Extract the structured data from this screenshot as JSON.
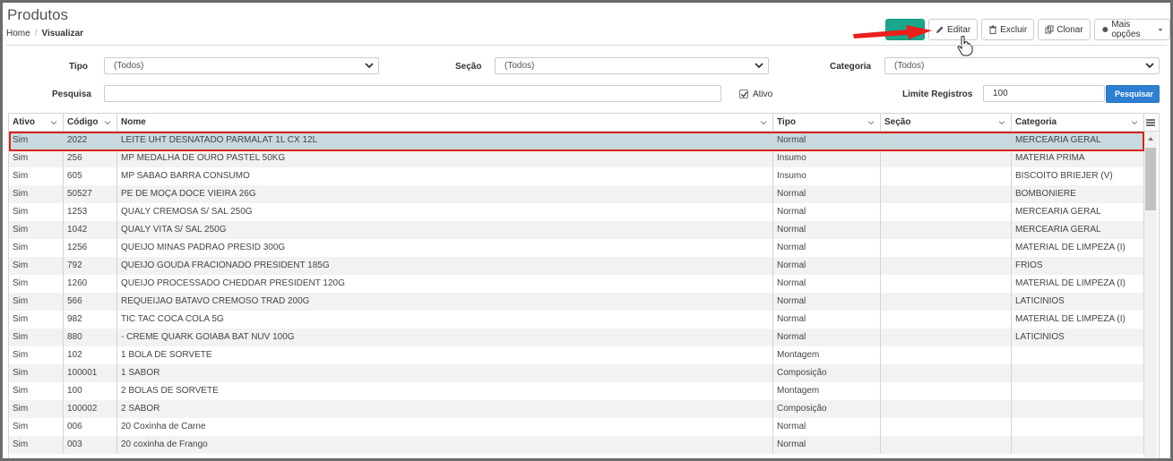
{
  "page": {
    "title": "Produtos"
  },
  "breadcrumb": {
    "home": "Home",
    "separator": "/",
    "current": "Visualizar"
  },
  "toolbar": {
    "editar": "Editar",
    "excluir": "Excluir",
    "clonar": "Clonar",
    "mais_opcoes": "Mais opções"
  },
  "filters": {
    "tipo_label": "Tipo",
    "tipo_value": "(Todos)",
    "secao_label": "Seção",
    "secao_value": "(Todos)",
    "categoria_label": "Categoria",
    "categoria_value": "(Todos)",
    "pesquisa_label": "Pesquisa",
    "pesquisa_value": "",
    "ativo_label": "Ativo",
    "ativo_checked": true,
    "limite_label": "Limite Registros",
    "limite_value": "100",
    "pesquisar_button": "Pesquisar"
  },
  "grid": {
    "columns": [
      "Ativo",
      "Código",
      "Nome",
      "Tipo",
      "Seção",
      "Categoria"
    ],
    "selected_row": 0,
    "rows": [
      [
        "Sim",
        "2022",
        "LEITE UHT DESNATADO PARMALAT 1L CX 12L",
        "Normal",
        "",
        "MERCEARIA GERAL"
      ],
      [
        "Sim",
        "256",
        "MP MEDALHA DE OURO PASTEL 50KG",
        "Insumo",
        "",
        "MATERIA PRIMA"
      ],
      [
        "Sim",
        "605",
        "MP SABAO BARRA CONSUMO",
        "Insumo",
        "",
        "BISCOITO BRIEJER (V)"
      ],
      [
        "Sim",
        "50527",
        "PE DE MOÇA DOCE VIEIRA 26G",
        "Normal",
        "",
        "BOMBONIERE"
      ],
      [
        "Sim",
        "1253",
        "QUALY CREMOSA S/ SAL 250G",
        "Normal",
        "",
        "MERCEARIA GERAL"
      ],
      [
        "Sim",
        "1042",
        "QUALY VITA S/ SAL 250G",
        "Normal",
        "",
        "MERCEARIA GERAL"
      ],
      [
        "Sim",
        "1256",
        "QUEIJO MINAS PADRAO PRESID 300G",
        "Normal",
        "",
        "MATERIAL DE LIMPEZA (I)"
      ],
      [
        "Sim",
        "792",
        "QUEIJO GOUDA FRACIONADO PRESIDENT 185G",
        "Normal",
        "",
        "FRIOS"
      ],
      [
        "Sim",
        "1260",
        "QUEIJO PROCESSADO CHEDDAR PRESIDENT 120G",
        "Normal",
        "",
        "MATERIAL DE LIMPEZA (I)"
      ],
      [
        "Sim",
        "566",
        "REQUEIJAO BATAVO CREMOSO TRAD 200G",
        "Normal",
        "",
        "LATICINIOS"
      ],
      [
        "Sim",
        "982",
        "TIC TAC COCA COLA 5G",
        "Normal",
        "",
        "MATERIAL DE LIMPEZA (I)"
      ],
      [
        "Sim",
        "880",
        "- CREME QUARK GOIABA BAT NUV 100G",
        "Normal",
        "",
        "LATICINIOS"
      ],
      [
        "Sim",
        "102",
        "1 BOLA DE SORVETE",
        "Montagem",
        "",
        ""
      ],
      [
        "Sim",
        "100001",
        "1 SABOR",
        "Composição",
        "",
        ""
      ],
      [
        "Sim",
        "100",
        "2 BOLAS DE SORVETE",
        "Montagem",
        "",
        ""
      ],
      [
        "Sim",
        "100002",
        "2 SABOR",
        "Composição",
        "",
        ""
      ],
      [
        "Sim",
        "006",
        "20 Coxinha de Carne",
        "Normal",
        "",
        ""
      ],
      [
        "Sim",
        "003",
        "20 coxinha de Frango",
        "Normal",
        "",
        ""
      ]
    ]
  },
  "colors": {
    "accent_green": "#1aa78c",
    "pesquisar_blue": "#2c7fd2",
    "selected_row": "#c9d9e0",
    "highlight_red": "#d9241c"
  },
  "icons": {
    "editar": "pencil-icon",
    "excluir": "trash-icon",
    "clonar": "copy-icon",
    "mais_opcoes": "circle-icon",
    "pesquisar": "search-icon",
    "grid_menu": "hamburger-menu-icon"
  }
}
